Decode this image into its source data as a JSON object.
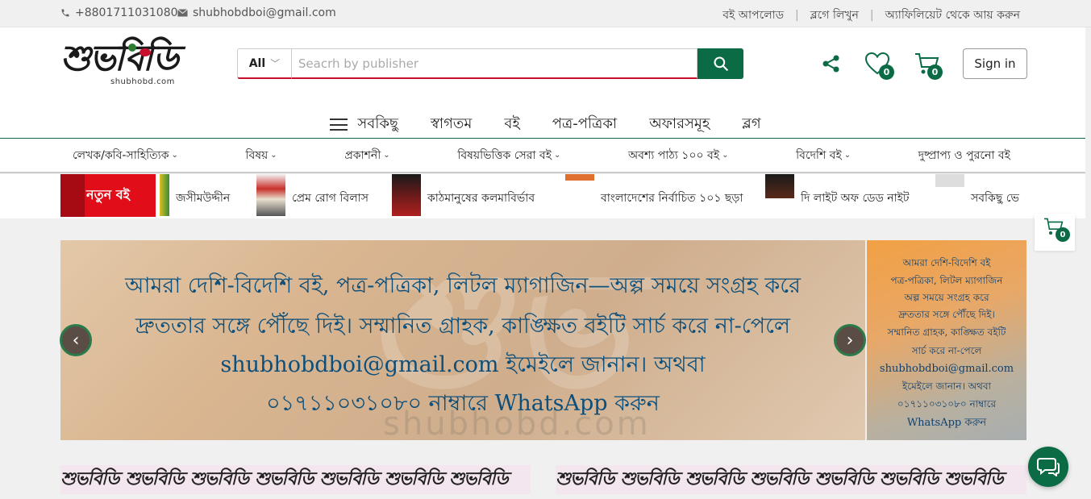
{
  "topbar": {
    "phone": "+8801711031080",
    "email": "shubhobdboi@gmail.com",
    "links": [
      "বই আপলোড",
      "ব্লগে লিখুন",
      "অ্যাফিলিয়েট থেকে আয় করুন"
    ]
  },
  "header": {
    "logo_text": "শুভবিডি",
    "logo_sub": "shubhobd.com",
    "search": {
      "category": "All",
      "placeholder": "Seacrh by publisher"
    },
    "wishlist_count": "0",
    "cart_count": "0",
    "signin_label": "Sign in"
  },
  "mainnav": {
    "items": [
      "সবকিছু",
      "স্বাগতম",
      "বই",
      "পত্র-পত্রিকা",
      "অফারসমূহ",
      "ব্লগ"
    ]
  },
  "catnav": {
    "items": [
      "লেখক/কবি-সাহিত্যিক",
      "বিষয়",
      "প্রকাশনী",
      "বিষয়ভিত্তিক সেরা বই",
      "অবশ্য পাঠ্য ১০০ বই",
      "বিদেশি বই",
      "দুষ্প্রাপ্য ও পুরনো বই"
    ]
  },
  "ticker": {
    "label": "নতুন বই",
    "items": [
      "জসীমউদ্দীন",
      "প্রেম রোগ বিলাস",
      "কাঠমানুষের কলমাবির্ভাব",
      "বাংলাদেশের নির্বাচিত ১০১ ছড়া",
      "দি লাইট অফ ডেড নাইট",
      "সবকিছু ভে"
    ]
  },
  "floatcart": {
    "count": "0"
  },
  "banner": {
    "line1": "আমরা দেশি-বিদেশি বই, পত্র-পত্রিকা, লিটল ম্যাগাজিন—অল্প সময়ে সংগ্রহ করে",
    "line2": "দ্রুততার সঙ্গে পৌঁছে দিই। সম্মানিত গ্রাহক, কাঙ্ক্ষিত বইটি সার্চ করে না-পেলে",
    "line3": "shubhobdboi@gmail.com ইমেইলে জানান। অথবা",
    "line4": "০১৭১১০৩১০৮০ নাম্বারে WhatsApp করুন",
    "watermark": "shubhobd.com"
  },
  "sidebanner": {
    "lines": [
      "আমরা দেশি-বিদেশি বই",
      "পত্র-পত্রিকা, লিটল ম্যাগাজিন",
      "অল্প সময়ে সংগ্রহ করে",
      "দ্রুততার সঙ্গে পৌঁছে দিই।",
      "সম্মানিত গ্রাহক, কাঙ্ক্ষিত বইটি",
      "সার্চ করে না-পেলে",
      "shubhobdboi@gmail.com",
      "ইমেইলে জানান। অথবা",
      "০১৭১১০৩১০৮০ নাম্বারে",
      "WhatsApp করুন"
    ]
  },
  "strip_logo": "শুভবিডি",
  "colors": {
    "brand_green": "#0a6b45",
    "brand_red": "#c8102e",
    "new_red": "#e10e1a"
  }
}
